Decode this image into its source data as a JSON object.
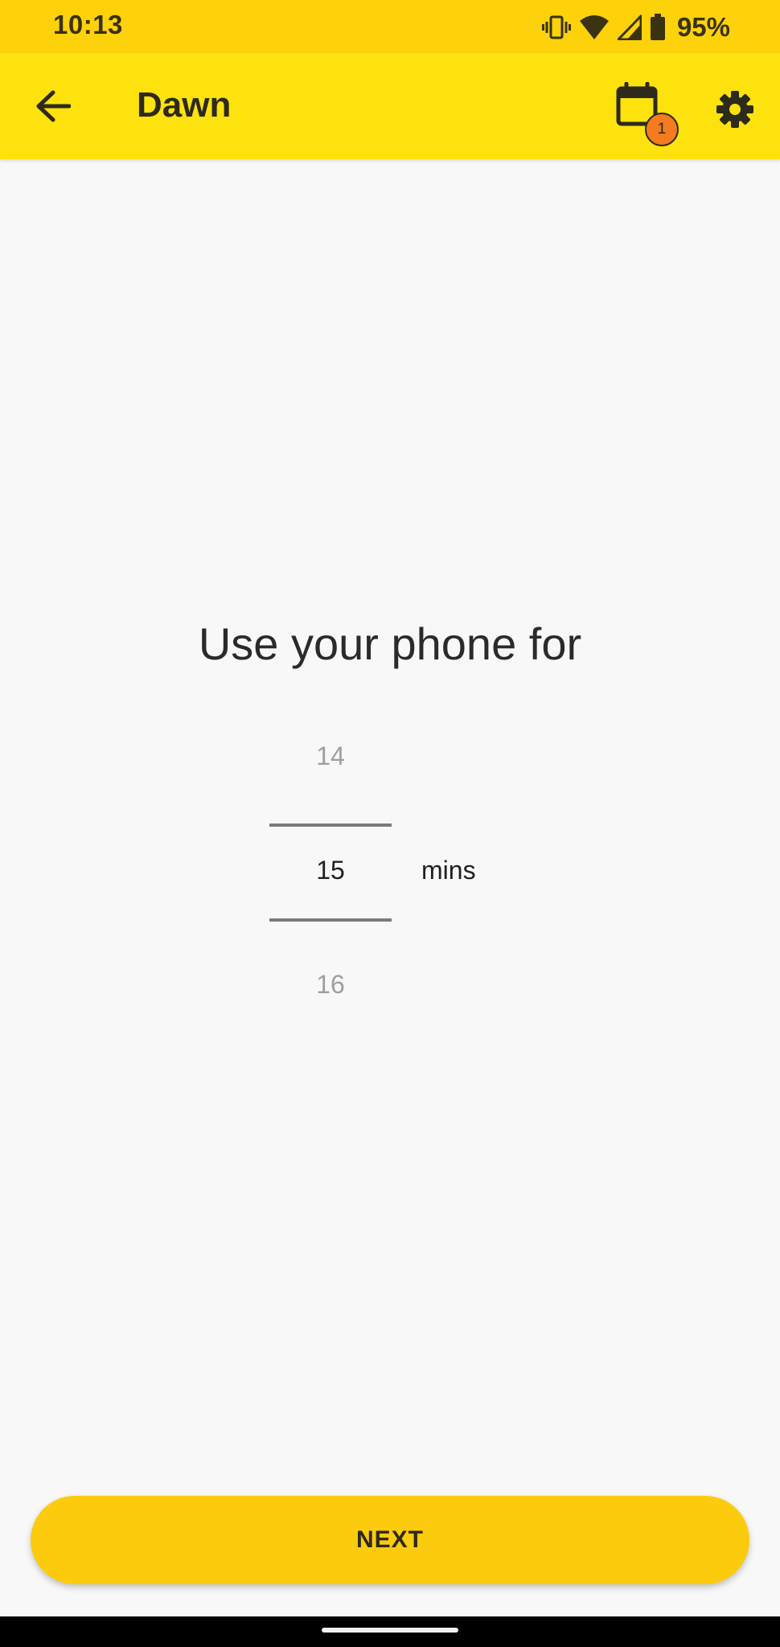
{
  "status_bar": {
    "time": "10:13",
    "battery_percent": "95%",
    "icons": [
      "vibrate-icon",
      "wifi-icon",
      "signal-icon",
      "battery-icon"
    ]
  },
  "app_bar": {
    "title": "Dawn",
    "back_icon": "arrow-back-icon",
    "calendar_icon": "calendar-icon",
    "calendar_badge_count": "1",
    "settings_icon": "gear-icon"
  },
  "main": {
    "prompt": "Use your phone for",
    "picker": {
      "previous_value": "14",
      "selected_value": "15",
      "next_value": "16",
      "unit": "mins"
    }
  },
  "actions": {
    "next_label": "NEXT"
  },
  "colors": {
    "status_bar_bg": "#fdd20b",
    "app_bar_bg": "#fde20d",
    "button_bg": "#fdcb0e",
    "badge_bg": "#f47b20",
    "page_bg": "#f7f8f7"
  }
}
